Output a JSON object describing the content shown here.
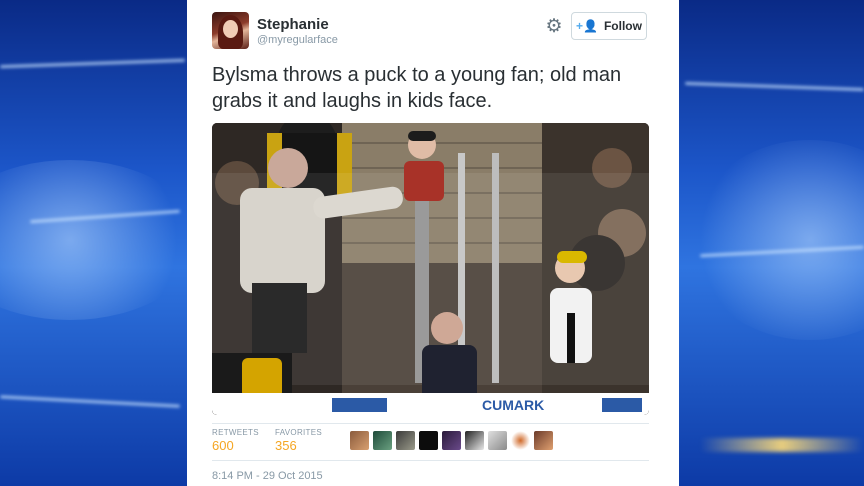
{
  "tweet": {
    "author_name": "Stephanie",
    "author_handle": "@myregularface",
    "follow_label": "Follow",
    "text": "Bylsma throws a puck to a young fan; old man grabs it and laughs in kids face.",
    "stats": {
      "retweets_label": "RETWEETS",
      "retweets_value": "600",
      "favorites_label": "FAVORITES",
      "favorites_value": "356"
    },
    "timestamp": "8:14 PM - 29 Oct 2015",
    "media_board_text": "CUMARK",
    "favoriter_avatars": [
      "avatar-1",
      "avatar-2",
      "avatar-3",
      "avatar-4",
      "avatar-5",
      "avatar-6",
      "avatar-7",
      "avatar-8",
      "avatar-9"
    ]
  },
  "icons": {
    "settings": "gear-icon",
    "follow": "add-user-icon"
  },
  "colors": {
    "background_blue": "#1c56c9",
    "card": "#ffffff",
    "text": "#292f33",
    "muted": "#8899a6",
    "stat_value": "#f5a623",
    "twitter_blue": "#55acee"
  }
}
